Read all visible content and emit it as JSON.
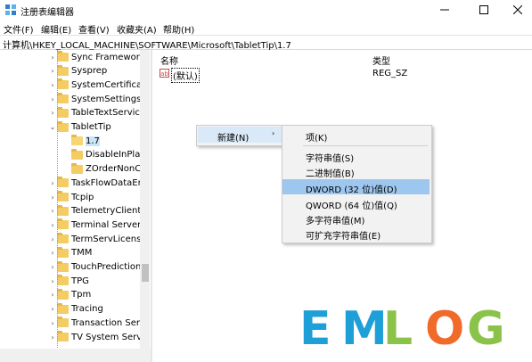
{
  "window": {
    "title": "注册表编辑器",
    "controls": [
      "minimize",
      "maximize",
      "close"
    ]
  },
  "menu": [
    "文件(F)",
    "编辑(E)",
    "查看(V)",
    "收藏夹(A)",
    "帮助(H)"
  ],
  "address": "计算机\\HKEY_LOCAL_MACHINE\\SOFTWARE\\Microsoft\\TabletTip\\1.7",
  "tree": [
    {
      "label": "Sync Framework",
      "expander": "›",
      "level": 0
    },
    {
      "label": "Sysprep",
      "expander": "›",
      "level": 0
    },
    {
      "label": "SystemCertificat",
      "expander": "›",
      "level": 0
    },
    {
      "label": "SystemSettings",
      "expander": "›",
      "level": 0
    },
    {
      "label": "TableTextServic",
      "expander": "›",
      "level": 0
    },
    {
      "label": "TabletTip",
      "expander": "⌄",
      "level": 0
    },
    {
      "label": "1.7",
      "expander": "",
      "level": 1,
      "selected": true
    },
    {
      "label": "DisableInPla",
      "expander": "",
      "level": 1
    },
    {
      "label": "ZOrderNonC",
      "expander": "",
      "level": 1
    },
    {
      "label": "TaskFlowDataEr",
      "expander": "›",
      "level": 0
    },
    {
      "label": "Tcpip",
      "expander": "›",
      "level": 0
    },
    {
      "label": "TelemetryClient",
      "expander": "›",
      "level": 0
    },
    {
      "label": "Terminal Server",
      "expander": "›",
      "level": 0
    },
    {
      "label": "TermServLicens",
      "expander": "›",
      "level": 0
    },
    {
      "label": "TMM",
      "expander": "›",
      "level": 0
    },
    {
      "label": "TouchPrediction",
      "expander": "›",
      "level": 0
    },
    {
      "label": "TPG",
      "expander": "›",
      "level": 0
    },
    {
      "label": "Tpm",
      "expander": "›",
      "level": 0
    },
    {
      "label": "Tracing",
      "expander": "›",
      "level": 0
    },
    {
      "label": "Transaction Ser",
      "expander": "›",
      "level": 0
    },
    {
      "label": "TV System Servi",
      "expander": "›",
      "level": 0
    }
  ],
  "list": {
    "col_name": "名称",
    "col_type": "类型",
    "rows": [
      {
        "icon": "ab",
        "name": "(默认)",
        "type": "REG_SZ"
      }
    ]
  },
  "context_menu": {
    "new_label": "新建(N)",
    "arrow": "›",
    "submenu": [
      "项(K)",
      "字符串值(S)",
      "二进制值(B)",
      "DWORD (32 位)值(D)",
      "QWORD (64 位)值(Q)",
      "多字符串值(M)",
      "可扩充字符串值(E)"
    ]
  },
  "watermark": {
    "letters": [
      "E",
      "M",
      "L",
      "O",
      "G"
    ],
    "colors": [
      "#1f9fd8",
      "#1f9fd8",
      "#8bc34a",
      "#f06a2a",
      "#8bc34a"
    ]
  }
}
